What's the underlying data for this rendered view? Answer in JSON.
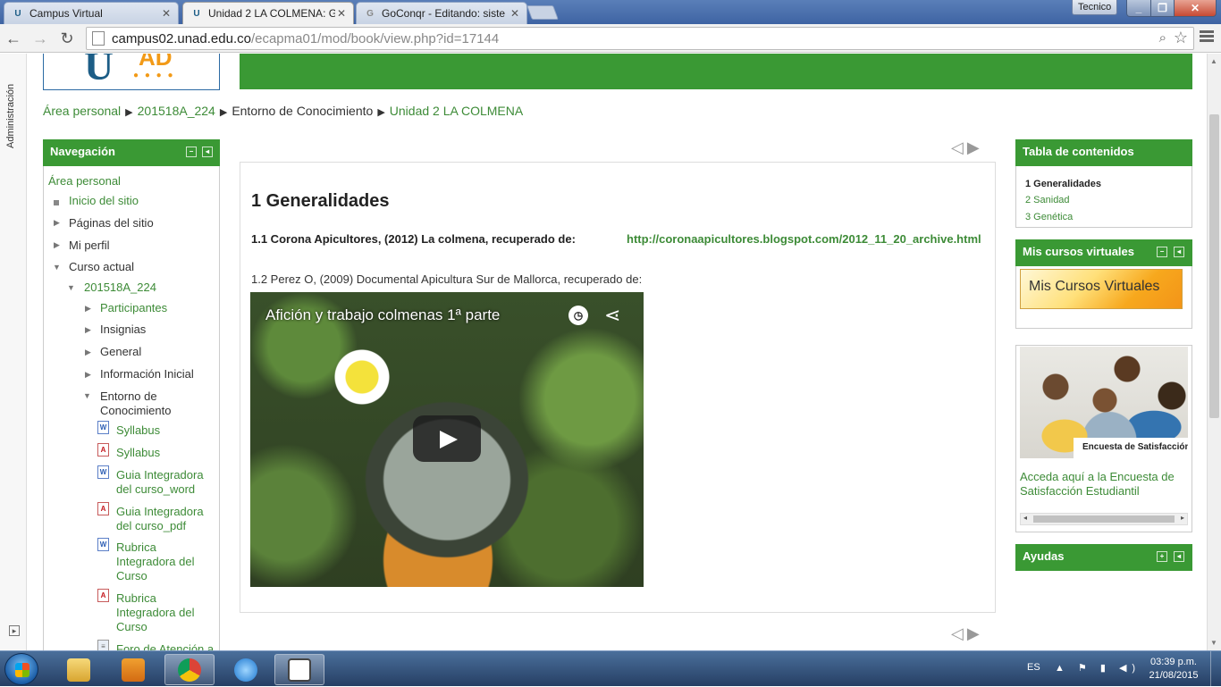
{
  "browser": {
    "tabs": [
      {
        "title": "Campus Virtual"
      },
      {
        "title": "Unidad 2 LA COLMENA: G"
      },
      {
        "title": "GoConqr - Editando: siste"
      }
    ],
    "profile_name": "Tecnico",
    "url_host": "campus02.unad.edu.co",
    "url_path": "/ecapma01/mod/book/view.php?id=17144"
  },
  "admin_strip": {
    "label": "Administración"
  },
  "breadcrumb": [
    {
      "label": "Área personal"
    },
    {
      "label": "201518A_224"
    },
    {
      "label": "Entorno de Conocimiento"
    },
    {
      "label": "Unidad 2 LA COLMENA"
    }
  ],
  "navigation": {
    "title": "Navegación",
    "items": [
      {
        "label": "Área personal"
      },
      {
        "label": "Inicio del sitio"
      },
      {
        "label": "Páginas del sitio"
      },
      {
        "label": "Mi perfil"
      },
      {
        "label": "Curso actual"
      },
      {
        "label": "201518A_224"
      },
      {
        "label": "Participantes"
      },
      {
        "label": "Insignias"
      },
      {
        "label": "General"
      },
      {
        "label": "Información Inicial"
      },
      {
        "label": "Entorno de Conocimiento"
      },
      {
        "label": "Syllabus"
      },
      {
        "label": "Syllabus"
      },
      {
        "label": "Guia Integradora del curso_word"
      },
      {
        "label": "Guia Integradora del curso_pdf"
      },
      {
        "label": "Rubrica Integradora del Curso"
      },
      {
        "label": "Rubrica Integradora del Curso"
      },
      {
        "label": "Foro de Atención a"
      }
    ]
  },
  "book": {
    "chapter_title": "1 Generalidades",
    "ref1": "1.1 Corona Apicultores, (2012) La colmena, recuperado de:",
    "ref1_link": "http://coronaapicultores.blogspot.com/2012_11_20_archive.html",
    "ref2": "1.2 Perez O, (2009) Documental Apicultura Sur de Mallorca, recuperado de:",
    "video_title": "Afición y trabajo colmenas 1ª parte"
  },
  "toc": {
    "title": "Tabla de contenidos",
    "items": [
      {
        "label": "1 Generalidades"
      },
      {
        "label": "2 Sanidad"
      },
      {
        "label": "3 Genética"
      }
    ]
  },
  "mis_cursos": {
    "title": "Mis cursos virtuales",
    "banner": "Mis Cursos Virtuales"
  },
  "encuesta": {
    "caption": "Encuesta de Satisfacción",
    "text": "Acceda aquí a la Encuesta de Satisfacción Estudiantil"
  },
  "ayudas": {
    "title": "Ayudas"
  },
  "taskbar": {
    "lang": "ES",
    "time": "03:39 p.m.",
    "date": "21/08/2015"
  }
}
